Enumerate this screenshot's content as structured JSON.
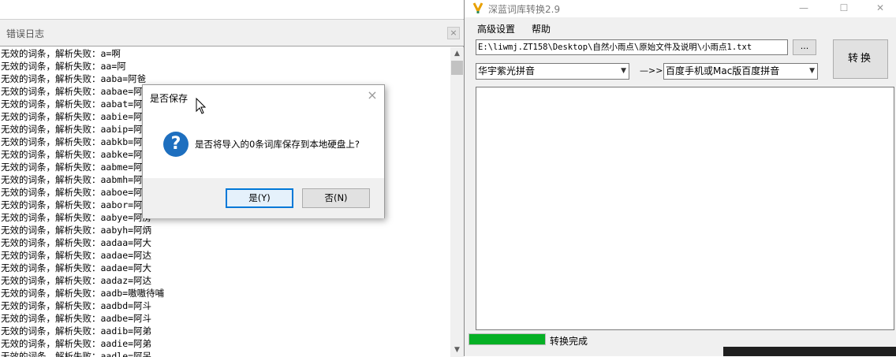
{
  "error_log": {
    "title": "错误日志",
    "close_label": "×",
    "lines": [
      {
        "prefix": "无效的词条，解析失败：",
        "entry": "a=啊"
      },
      {
        "prefix": "无效的词条，解析失败：",
        "entry": "aa=阿"
      },
      {
        "prefix": "无效的词条，解析失败：",
        "entry": "aaba=阿爸"
      },
      {
        "prefix": "无效的词条，解析失败：",
        "entry": "aabae=阿"
      },
      {
        "prefix": "无效的词条，解析失败：",
        "entry": "aabat=阿"
      },
      {
        "prefix": "无效的词条，解析失败：",
        "entry": "aabie=阿"
      },
      {
        "prefix": "无效的词条，解析失败：",
        "entry": "aabip=阿"
      },
      {
        "prefix": "无效的词条，解析失败：",
        "entry": "aabkb=阿"
      },
      {
        "prefix": "无效的词条，解析失败：",
        "entry": "aabke=阿"
      },
      {
        "prefix": "无效的词条，解析失败：",
        "entry": "aabme=阿"
      },
      {
        "prefix": "无效的词条，解析失败：",
        "entry": "aabmh=阿"
      },
      {
        "prefix": "无效的词条，解析失败：",
        "entry": "aaboe=阿"
      },
      {
        "prefix": "无效的词条，解析失败：",
        "entry": "aabor=阿"
      },
      {
        "prefix": "无效的词条，解析失败：",
        "entry": "aabye=阿房"
      },
      {
        "prefix": "无效的词条，解析失败：",
        "entry": "aabyh=阿炳"
      },
      {
        "prefix": "无效的词条，解析失败：",
        "entry": "aadaa=阿大"
      },
      {
        "prefix": "无效的词条，解析失败：",
        "entry": "aadae=阿达"
      },
      {
        "prefix": "无效的词条，解析失败：",
        "entry": "aadae=阿大"
      },
      {
        "prefix": "无效的词条，解析失败：",
        "entry": "aadaz=阿达"
      },
      {
        "prefix": "无效的词条，解析失败：",
        "entry": "aadb=嗷嗷待哺"
      },
      {
        "prefix": "无效的词条，解析失败：",
        "entry": "aadbd=阿斗"
      },
      {
        "prefix": "无效的词条，解析失败：",
        "entry": "aadbe=阿斗"
      },
      {
        "prefix": "无效的词条，解析失败：",
        "entry": "aadib=阿弟"
      },
      {
        "prefix": "无效的词条，解析失败：",
        "entry": "aadie=阿弟"
      },
      {
        "prefix": "无效的词条，解析失败：",
        "entry": "aadle=阿呆"
      }
    ],
    "scrollbar": {
      "up": "▲",
      "down": "▼"
    }
  },
  "dialog": {
    "title": "是否保存",
    "close_label": "×",
    "icon": "question-icon",
    "icon_glyph": "?",
    "message": "是否将导入的0条词库保存到本地硬盘上?",
    "yes_label": "是(Y)",
    "no_label": "否(N)"
  },
  "converter": {
    "title": "深蓝词库转换2.9",
    "minimize": "—",
    "maximize": "☐",
    "close": "✕",
    "menu": [
      "高级设置",
      "帮助"
    ],
    "path_value": "E:\\liwmj.ZT158\\Desktop\\自然小雨点\\原始文件及说明\\小雨点1.txt",
    "browse_label": "...",
    "convert_label": "转换",
    "source_format": "华宇紫光拼音",
    "arrow_text": "—>>",
    "target_format": "百度手机或Mac版百度拼音",
    "dropdown_glyph": "▼",
    "status_text": "转换完成",
    "progress": 1.0,
    "progress_color": "#06b025"
  }
}
